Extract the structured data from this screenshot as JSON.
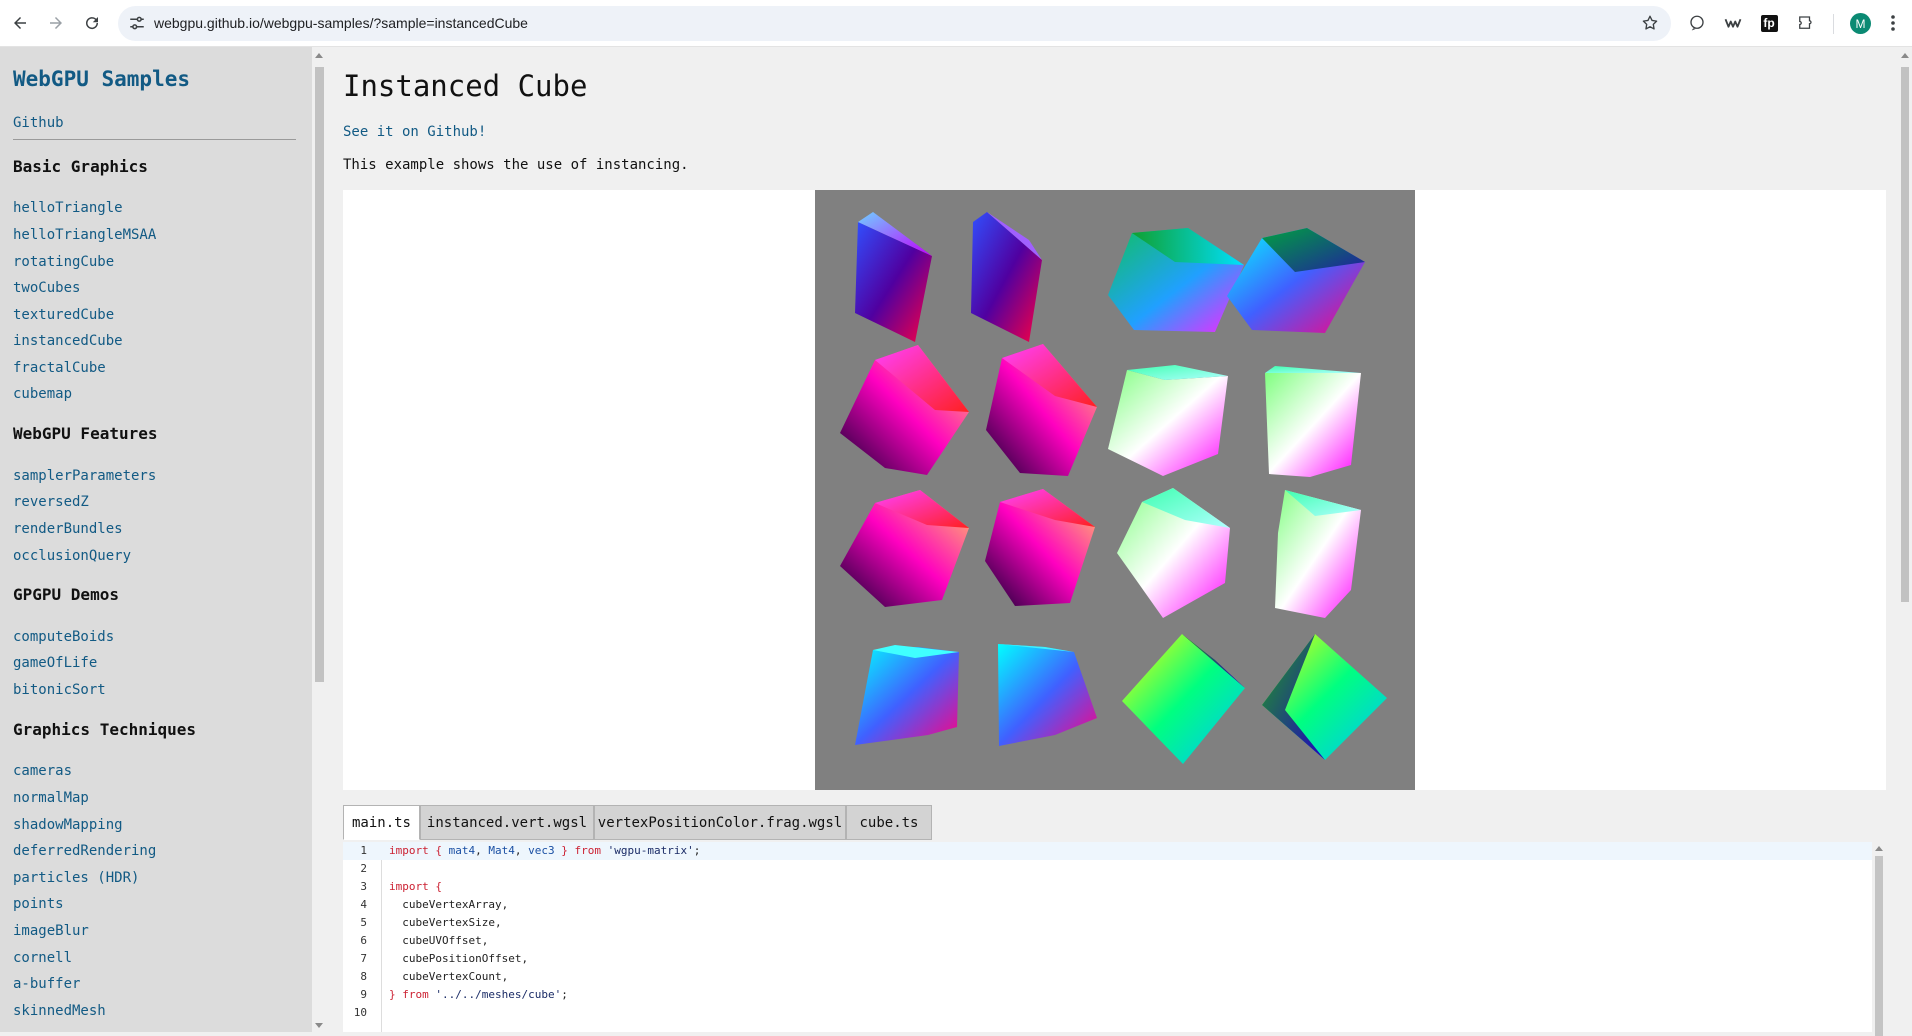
{
  "browser": {
    "url": "webgpu.github.io/webgpu-samples/?sample=instancedCube",
    "avatar_letter": "M",
    "fp_label": "fp",
    "accent": "#0b8a73"
  },
  "sidebar": {
    "title": "WebGPU Samples",
    "github": "Github",
    "sections": [
      {
        "heading": "Basic Graphics",
        "items": [
          "helloTriangle",
          "helloTriangleMSAA",
          "rotatingCube",
          "twoCubes",
          "texturedCube",
          "instancedCube",
          "fractalCube",
          "cubemap"
        ]
      },
      {
        "heading": "WebGPU Features",
        "items": [
          "samplerParameters",
          "reversedZ",
          "renderBundles",
          "occlusionQuery"
        ]
      },
      {
        "heading": "GPGPU Demos",
        "items": [
          "computeBoids",
          "gameOfLife",
          "bitonicSort"
        ]
      },
      {
        "heading": "Graphics Techniques",
        "items": [
          "cameras",
          "normalMap",
          "shadowMapping",
          "deferredRendering",
          "particles (HDR)",
          "points",
          "imageBlur",
          "cornell",
          "a-buffer",
          "skinnedMesh"
        ]
      }
    ]
  },
  "main": {
    "title": "Instanced Cube",
    "github_link": "See it on Github!",
    "description": "This example shows the use of instancing.",
    "canvas_background": "#808080",
    "tabs": [
      "main.ts",
      "instanced.vert.wgsl",
      "vertexPositionColor.frag.wgsl",
      "cube.ts"
    ],
    "active_tab": 0,
    "code_lines": [
      "import { mat4, Mat4, vec3 } from 'wgpu-matrix';",
      "",
      "import {",
      "  cubeVertexArray,",
      "  cubeVertexSize,",
      "  cubeUVOffset,",
      "  cubePositionOffset,",
      "  cubeVertexCount,",
      "} from '../../meshes/cube';",
      ""
    ]
  }
}
